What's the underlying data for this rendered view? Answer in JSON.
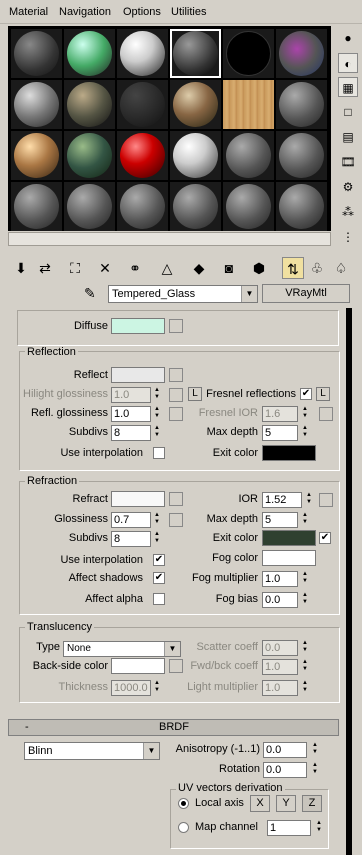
{
  "menu": {
    "material": "Material",
    "navigation": "Navigation",
    "options": "Options",
    "utilities": "Utilities"
  },
  "material_name": "Tempered_Glass",
  "material_type": "VRayMtl",
  "basic": {
    "diffuse": "Diffuse",
    "diffuse_color": "#ccf5e3"
  },
  "reflection": {
    "title": "Reflection",
    "reflect": "Reflect",
    "reflect_color": "#e8e8e8",
    "hilight_glossiness": "Hilight glossiness",
    "hilight_value": "1.0",
    "lock_label": "L",
    "refl_glossiness": "Refl. glossiness",
    "refl_glossiness_value": "1.0",
    "subdivs": "Subdivs",
    "subdivs_value": "8",
    "use_interp": "Use interpolation",
    "fresnel": "Fresnel reflections",
    "fresnel_lock": "L",
    "fresnel_ior": "Fresnel IOR",
    "fresnel_ior_value": "1.6",
    "max_depth": "Max depth",
    "max_depth_value": "5",
    "exit_color": "Exit color",
    "exit_color_value": "#000000"
  },
  "refraction": {
    "title": "Refraction",
    "refract": "Refract",
    "refract_color": "#f8f8f8",
    "glossiness": "Glossiness",
    "glossiness_value": "0.7",
    "subdivs": "Subdivs",
    "subdivs_value": "8",
    "use_interp": "Use interpolation",
    "affect_shadows": "Affect shadows",
    "affect_alpha": "Affect alpha",
    "ior": "IOR",
    "ior_value": "1.52",
    "max_depth": "Max depth",
    "max_depth_value": "5",
    "exit_color": "Exit color",
    "exit_color_value": "#2f4030",
    "fog_color": "Fog color",
    "fog_color_value": "#ffffff",
    "fog_mult": "Fog multiplier",
    "fog_mult_value": "1.0",
    "fog_bias": "Fog bias",
    "fog_bias_value": "0.0"
  },
  "translucency": {
    "title": "Translucency",
    "type": "Type",
    "type_value": "None",
    "back_side": "Back-side color",
    "back_side_color": "#ffffff",
    "thickness": "Thickness",
    "thickness_value": "1000.0",
    "scatter": "Scatter coeff",
    "scatter_value": "0.0",
    "fwd": "Fwd/bck coeff",
    "fwd_value": "1.0",
    "light_mult": "Light multiplier",
    "light_mult_value": "1.0"
  },
  "brdf": {
    "title": "BRDF",
    "collapse": "-",
    "type": "Blinn",
    "anisotropy": "Anisotropy (-1..1)",
    "anisotropy_value": "0.0",
    "rotation": "Rotation",
    "rotation_value": "0.0",
    "uv_title": "UV vectors derivation",
    "local_axis": "Local axis",
    "x": "X",
    "y": "Y",
    "z": "Z",
    "map_channel": "Map channel",
    "map_channel_value": "1"
  }
}
